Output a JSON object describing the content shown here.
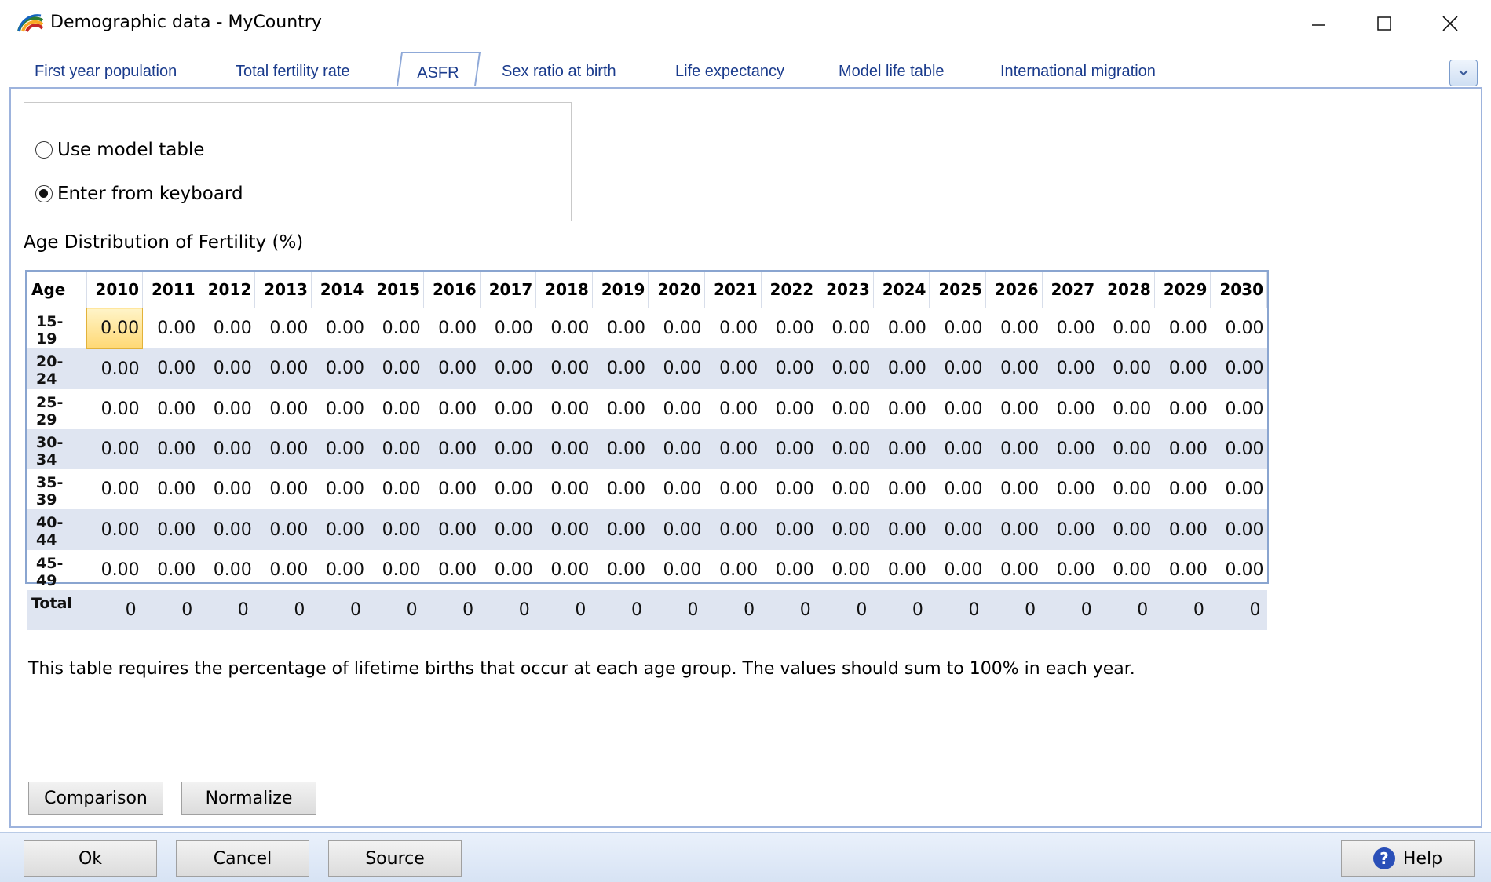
{
  "window": {
    "title": "Demographic data - MyCountry"
  },
  "tabs": [
    {
      "label": "First year population"
    },
    {
      "label": "Total fertility rate"
    },
    {
      "label": "ASFR"
    },
    {
      "label": "Sex ratio at birth"
    },
    {
      "label": "Life expectancy"
    },
    {
      "label": "Model life table"
    },
    {
      "label": "International migration"
    }
  ],
  "active_tab": "ASFR",
  "options": {
    "use_model": "Use model table",
    "enter_keyboard": "Enter from keyboard",
    "selected": "Enter from keyboard"
  },
  "grid": {
    "title": "Age Distribution of Fertility (%)",
    "age_header": "Age",
    "years": [
      "2010",
      "2011",
      "2012",
      "2013",
      "2014",
      "2015",
      "2016",
      "2017",
      "2018",
      "2019",
      "2020",
      "2021",
      "2022",
      "2023",
      "2024",
      "2025",
      "2026",
      "2027",
      "2028",
      "2029",
      "2030"
    ],
    "rows": [
      {
        "age": "15-19",
        "values": [
          "0.00",
          "0.00",
          "0.00",
          "0.00",
          "0.00",
          "0.00",
          "0.00",
          "0.00",
          "0.00",
          "0.00",
          "0.00",
          "0.00",
          "0.00",
          "0.00",
          "0.00",
          "0.00",
          "0.00",
          "0.00",
          "0.00",
          "0.00",
          "0.00"
        ]
      },
      {
        "age": "20-24",
        "values": [
          "0.00",
          "0.00",
          "0.00",
          "0.00",
          "0.00",
          "0.00",
          "0.00",
          "0.00",
          "0.00",
          "0.00",
          "0.00",
          "0.00",
          "0.00",
          "0.00",
          "0.00",
          "0.00",
          "0.00",
          "0.00",
          "0.00",
          "0.00",
          "0.00"
        ]
      },
      {
        "age": "25-29",
        "values": [
          "0.00",
          "0.00",
          "0.00",
          "0.00",
          "0.00",
          "0.00",
          "0.00",
          "0.00",
          "0.00",
          "0.00",
          "0.00",
          "0.00",
          "0.00",
          "0.00",
          "0.00",
          "0.00",
          "0.00",
          "0.00",
          "0.00",
          "0.00",
          "0.00"
        ]
      },
      {
        "age": "30-34",
        "values": [
          "0.00",
          "0.00",
          "0.00",
          "0.00",
          "0.00",
          "0.00",
          "0.00",
          "0.00",
          "0.00",
          "0.00",
          "0.00",
          "0.00",
          "0.00",
          "0.00",
          "0.00",
          "0.00",
          "0.00",
          "0.00",
          "0.00",
          "0.00",
          "0.00"
        ]
      },
      {
        "age": "35-39",
        "values": [
          "0.00",
          "0.00",
          "0.00",
          "0.00",
          "0.00",
          "0.00",
          "0.00",
          "0.00",
          "0.00",
          "0.00",
          "0.00",
          "0.00",
          "0.00",
          "0.00",
          "0.00",
          "0.00",
          "0.00",
          "0.00",
          "0.00",
          "0.00",
          "0.00"
        ]
      },
      {
        "age": "40-44",
        "values": [
          "0.00",
          "0.00",
          "0.00",
          "0.00",
          "0.00",
          "0.00",
          "0.00",
          "0.00",
          "0.00",
          "0.00",
          "0.00",
          "0.00",
          "0.00",
          "0.00",
          "0.00",
          "0.00",
          "0.00",
          "0.00",
          "0.00",
          "0.00",
          "0.00"
        ]
      },
      {
        "age": "45-49",
        "values": [
          "0.00",
          "0.00",
          "0.00",
          "0.00",
          "0.00",
          "0.00",
          "0.00",
          "0.00",
          "0.00",
          "0.00",
          "0.00",
          "0.00",
          "0.00",
          "0.00",
          "0.00",
          "0.00",
          "0.00",
          "0.00",
          "0.00",
          "0.00",
          "0.00"
        ]
      }
    ],
    "total": {
      "label": "Total",
      "values": [
        "0",
        "0",
        "0",
        "0",
        "0",
        "0",
        "0",
        "0",
        "0",
        "0",
        "0",
        "0",
        "0",
        "0",
        "0",
        "0",
        "0",
        "0",
        "0",
        "0",
        "0"
      ]
    }
  },
  "note": "This table requires the percentage of lifetime births that occur at each age group. The values should sum to 100% in each year.",
  "buttons": {
    "comparison": "Comparison",
    "normalize": "Normalize",
    "ok": "Ok",
    "cancel": "Cancel",
    "source": "Source",
    "help": "Help"
  },
  "colors": {
    "tab_text": "#1a3b8c",
    "grid_alt_row": "#dfe5f1",
    "selected_cell": "#ffd873",
    "border_blue": "#8aa5d0"
  }
}
